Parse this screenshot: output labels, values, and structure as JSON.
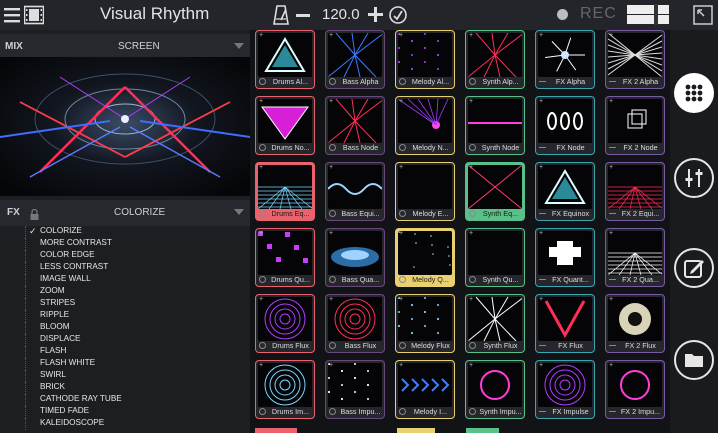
{
  "app": {
    "title": "Visual Rhythm",
    "bpm": "120.0",
    "rec_label": "REC"
  },
  "mix": {
    "label": "MIX",
    "mode": "SCREEN"
  },
  "fx": {
    "label": "FX",
    "selected": "COLORIZE",
    "items": [
      "COLORIZE",
      "MORE CONTRAST",
      "COLOR EDGE",
      "LESS CONTRAST",
      "IMAGE WALL",
      "ZOOM",
      "STRIPES",
      "RIPPLE",
      "BLOOM",
      "DISPLACE",
      "FLASH",
      "FLASH WHITE",
      "SWIRL",
      "BRICK",
      "CATHODE RAY TUBE",
      "TIMED FADE",
      "KALEIDOSCOPE"
    ]
  },
  "grid": {
    "rows": [
      [
        "Drums Al...",
        "Bass Alpha",
        "Melody Al...",
        "Synth Alp...",
        "FX Alpha",
        "FX 2 Alpha"
      ],
      [
        "Drums No...",
        "Bass Node",
        "Melody N...",
        "Synth Node",
        "FX Node",
        "FX 2 Node"
      ],
      [
        "Drums Eq...",
        "Bass Equi...",
        "Melody E...",
        "Synth Eq...",
        "FX Equinox",
        "FX 2 Equi..."
      ],
      [
        "Drums Qu...",
        "Bass Qua...",
        "Melody Q...",
        "Synth Qu...",
        "FX Quant...",
        "FX 2 Qua..."
      ],
      [
        "Drums Flux",
        "Bass Flux",
        "Melody Flux",
        "Synth Flux",
        "FX Flux",
        "FX 2 Flux"
      ],
      [
        "Drums Im...",
        "Bass Impu...",
        "Melody I...",
        "Synth Impu...",
        "FX Impulse",
        "FX 2 Impu..."
      ]
    ]
  },
  "colors": {
    "drums": "#e9636e",
    "bass": "#6a4a7a",
    "melody": "#e9d070",
    "synth": "#59c089",
    "fx": "#3aa6b0",
    "fx2": "#7a5aa0"
  }
}
